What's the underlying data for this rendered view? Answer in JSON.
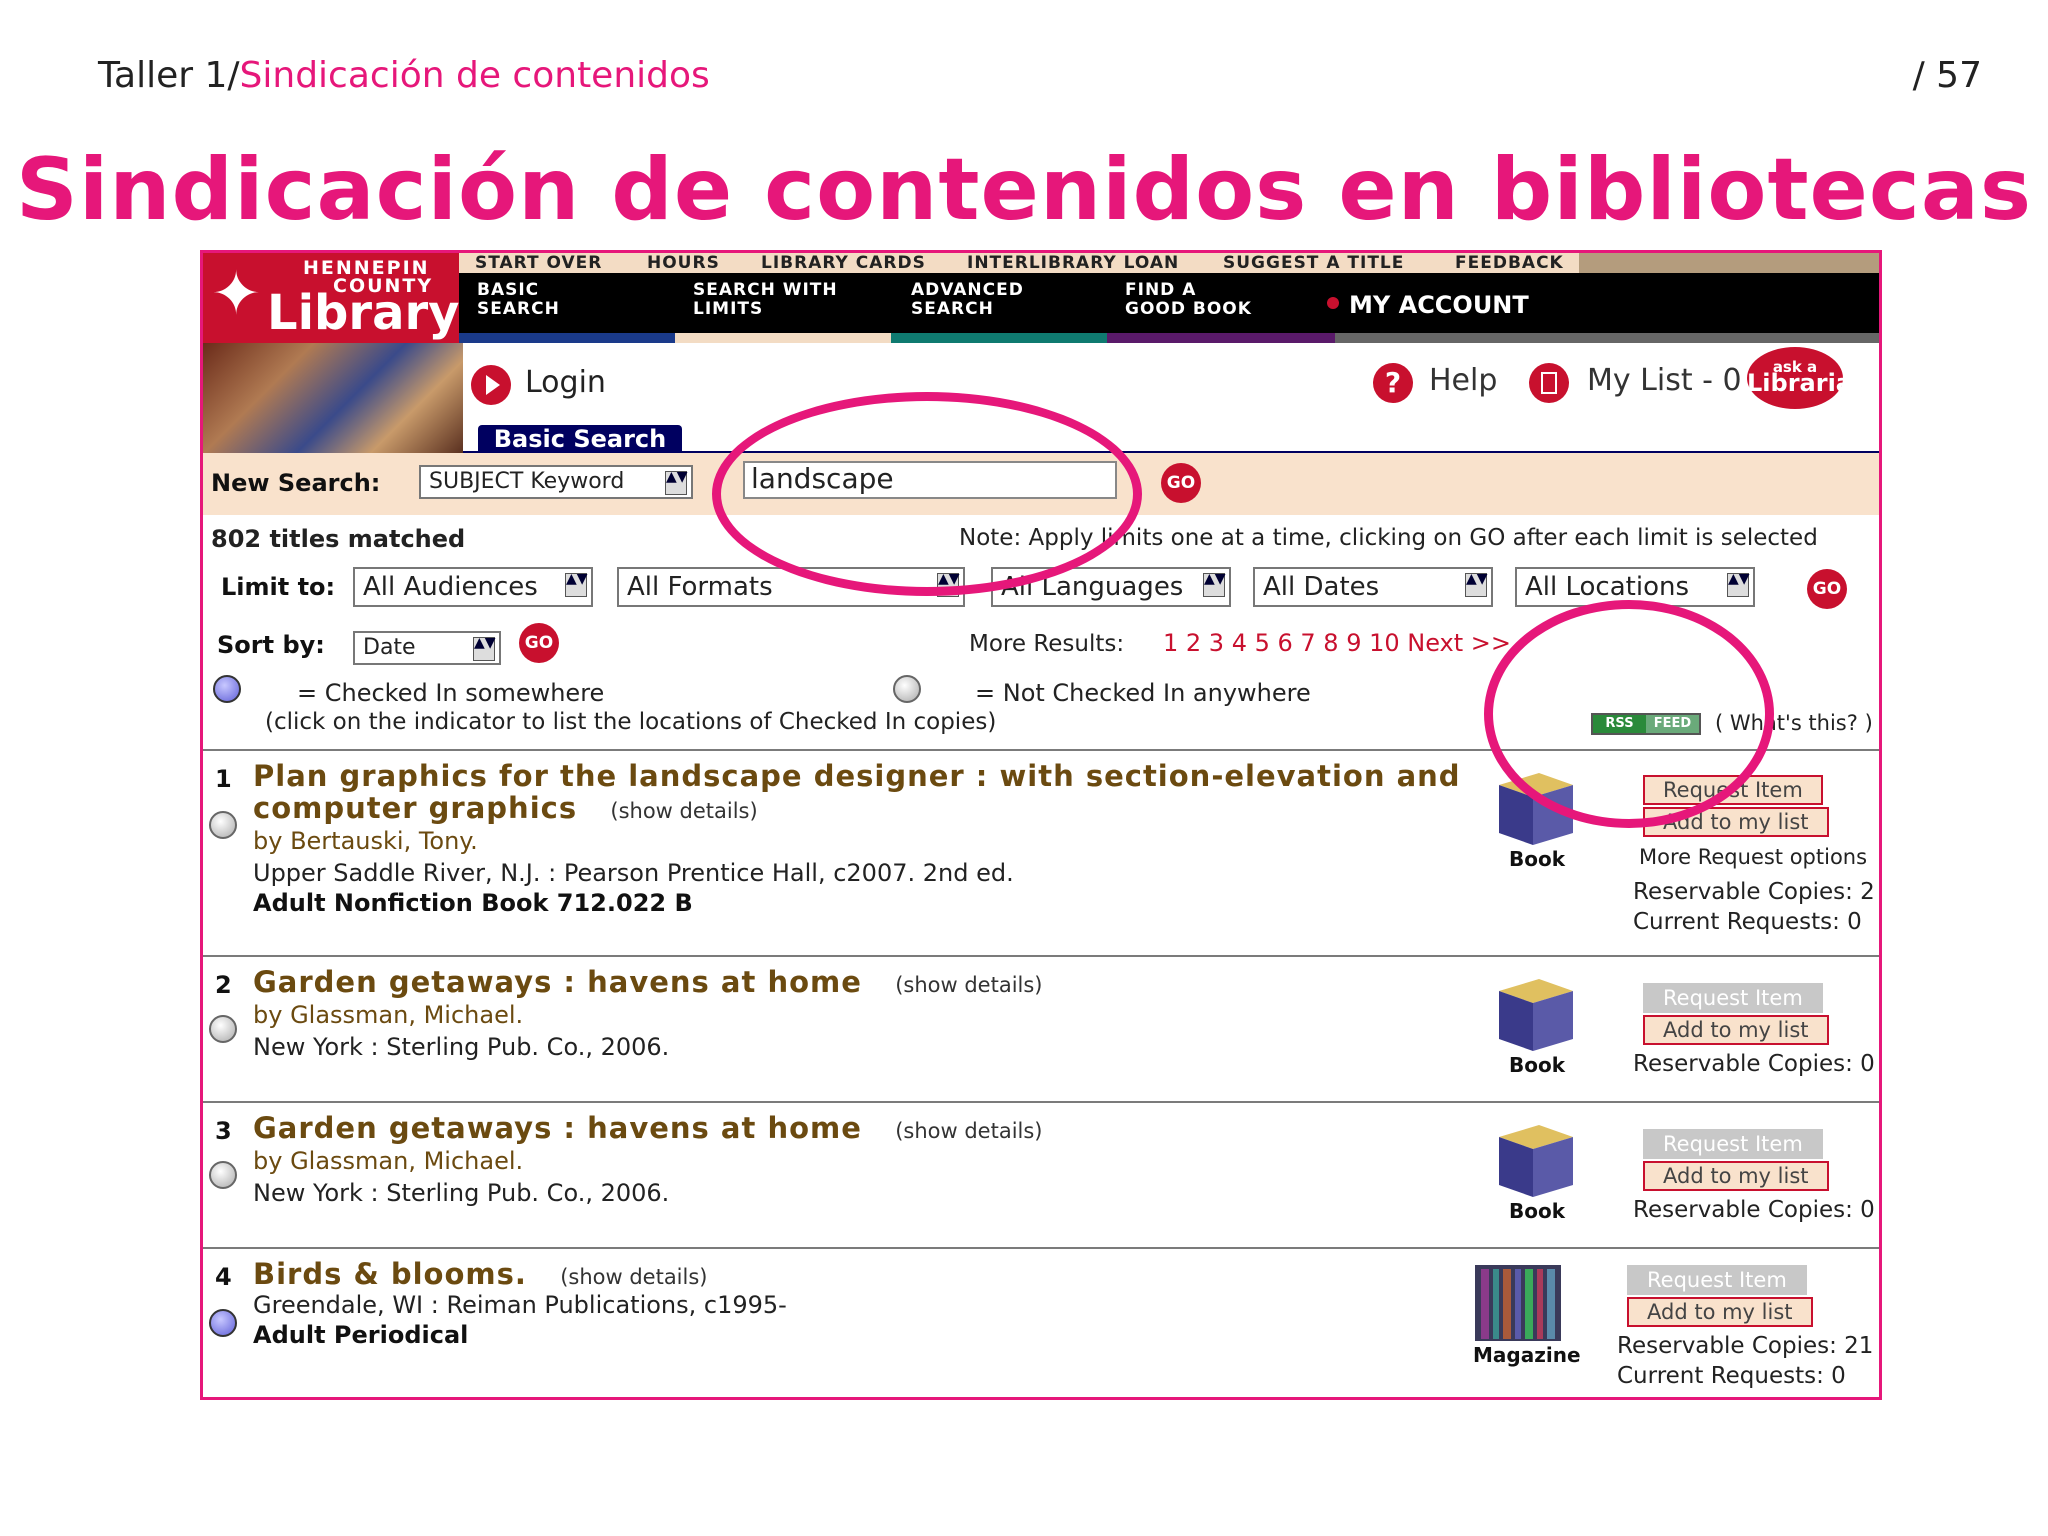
{
  "slide": {
    "header_prefix": "Taller 1/",
    "header_section": "Sindicación de contenidos",
    "page": "/ 57",
    "title": "Sindicación de contenidos en bibliotecas"
  },
  "logo": {
    "line1": "HENNEPIN",
    "line2": "COUNTY",
    "line3": "Library"
  },
  "toplinks": [
    "START OVER",
    "HOURS",
    "LIBRARY CARDS",
    "INTERLIBRARY LOAN",
    "SUGGEST A TITLE",
    "FEEDBACK"
  ],
  "nav": {
    "basic": "BASIC\nSEARCH",
    "limits": "SEARCH WITH\nLIMITS",
    "advanced": "ADVANCED\nSEARCH",
    "findbook": "FIND A\nGOOD BOOK",
    "myaccount": "MY ACCOUNT"
  },
  "util": {
    "login": "Login",
    "help": "Help",
    "mylist": "My List - 0",
    "ask_top": "ask a",
    "ask_bottom": "Librarian"
  },
  "tab": "Basic Search",
  "search": {
    "label": "New Search:",
    "type": "SUBJECT Keyword",
    "query": "landscape",
    "go": "GO"
  },
  "results_info": {
    "matched": "802 titles matched",
    "note": "Note: Apply limits one at a time, clicking on GO after each limit is selected",
    "limit_label": "Limit to:",
    "limits": [
      "All Audiences",
      "All Formats",
      "All Languages",
      "All Dates",
      "All Locations"
    ],
    "sort_label": "Sort by:",
    "sort_value": "Date",
    "more_label": "More Results:",
    "pages": "1 2 3 4 5 6 7 8 9 10 Next >>",
    "checked_in": "= Checked In somewhere",
    "not_checked": "= Not Checked In anywhere",
    "click_note": "(click on the indicator to list the locations of Checked In copies)",
    "rss_a": "RSS",
    "rss_b": "FEED",
    "whats_this": "( What's this? )"
  },
  "results": [
    {
      "num": "1",
      "title1": "Plan graphics for the landscape designer : with section-elevation and",
      "title2": "computer graphics",
      "show": "(show details)",
      "author": "by Bertauski, Tony.",
      "pub": "Upper Saddle River, N.J. : Pearson Prentice Hall, c2007.   2nd ed.",
      "call": "Adult Nonfiction Book 712.022 B",
      "type": "Book",
      "request": "Request Item",
      "add": "Add to my list",
      "more": "More Request options",
      "reservable": "Reservable Copies:  2",
      "current": "Current Requests:   0"
    },
    {
      "num": "2",
      "title1": "Garden getaways : havens at home",
      "show": "(show details)",
      "author": "by Glassman, Michael.",
      "pub": "New York : Sterling Pub. Co., 2006.",
      "type": "Book",
      "request": "Request Item",
      "add": "Add to my list",
      "reservable": "Reservable Copies:  0"
    },
    {
      "num": "3",
      "title1": "Garden getaways : havens at home",
      "show": "(show details)",
      "author": "by Glassman, Michael.",
      "pub": "New York : Sterling Pub. Co., 2006.",
      "type": "Book",
      "request": "Request Item",
      "add": "Add to my list",
      "reservable": "Reservable Copies:  0"
    },
    {
      "num": "4",
      "title1": "Birds & blooms.",
      "show": "(show details)",
      "pub": "Greendale, WI : Reiman Publications, c1995-",
      "call": "Adult Periodical",
      "type": "Magazine",
      "request": "Request Item",
      "add": "Add to my list",
      "reservable": "Reservable Copies:  21",
      "current": "Current Requests:    0"
    }
  ],
  "colors": {
    "accent": "#e6177a",
    "brand": "#c8102e",
    "title_brown": "#6b4a10"
  }
}
